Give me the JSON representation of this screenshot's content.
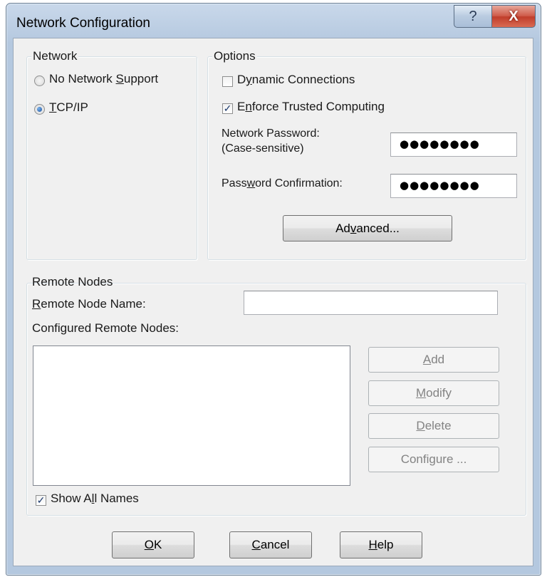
{
  "window": {
    "title": "Network Configuration",
    "help_glyph": "?",
    "close_glyph": "X"
  },
  "network": {
    "group_label": "Network",
    "options": [
      {
        "label_pre": "No Network ",
        "label_key": "S",
        "label_post": "upport",
        "selected": false
      },
      {
        "label_pre": "",
        "label_key": "T",
        "label_post": "CP/IP",
        "selected": true
      }
    ]
  },
  "options": {
    "group_label": "Options",
    "dynamic_connections": {
      "label_pre": "D",
      "label_key": "y",
      "label_post": "namic Connections",
      "checked": false
    },
    "enforce_trusted": {
      "label_pre": "E",
      "label_key": "n",
      "label_post": "force Trusted Computing",
      "checked": true
    },
    "network_password_label_1": "Network Password:",
    "network_password_label_2": "(Case-sensitive)",
    "network_password_value": "●●●●●●●●",
    "password_confirmation": {
      "label_pre": "Pass",
      "label_key": "w",
      "label_post": "ord Confirmation:"
    },
    "password_confirmation_value": "●●●●●●●●",
    "advanced_button": {
      "label_pre": "Ad",
      "label_key": "v",
      "label_post": "anced..."
    }
  },
  "remote_nodes": {
    "group_label": "Remote Nodes",
    "name_label": {
      "label_pre": "",
      "label_key": "R",
      "label_post": "emote Node Name:"
    },
    "name_value": "",
    "configured_label": "Configured Remote Nodes:",
    "add_button": {
      "label_pre": "",
      "label_key": "A",
      "label_post": "dd"
    },
    "modify_button": {
      "label_pre": "",
      "label_key": "M",
      "label_post": "odify"
    },
    "delete_button": {
      "label_pre": "",
      "label_key": "D",
      "label_post": "elete"
    },
    "configure_button": {
      "label_pre": "Confi",
      "label_key": "g",
      "label_post": "ure ..."
    },
    "show_all_names": {
      "label_pre": "Show A",
      "label_key": "l",
      "label_post": "l Names",
      "checked": true
    },
    "check_glyph": "✓"
  },
  "footer": {
    "ok_button": {
      "label_pre": "",
      "label_key": "O",
      "label_post": "K"
    },
    "cancel_button": {
      "label_pre": "",
      "label_key": "C",
      "label_post": "ancel"
    },
    "help_button": {
      "label_pre": "",
      "label_key": "H",
      "label_post": "elp"
    }
  }
}
